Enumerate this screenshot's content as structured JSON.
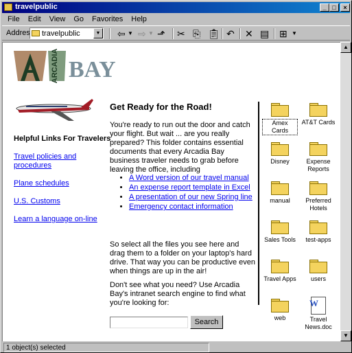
{
  "window": {
    "title": "travelpublic"
  },
  "menu": {
    "items": [
      "File",
      "Edit",
      "View",
      "Go",
      "Favorites",
      "Help"
    ]
  },
  "toolbar": {
    "address_label": "Address",
    "address_value": "travelpublic"
  },
  "logo": {
    "letter": "A",
    "word1": "ARCADIA",
    "word2": "BAY"
  },
  "sidebar": {
    "heading": "Helpful Links For Travelers",
    "links": [
      "Travel policies and procedures",
      "Plane schedules",
      "U.S. Customs",
      "Learn a language on-line"
    ]
  },
  "main": {
    "heading": "Get Ready for the Road!",
    "intro": "You're ready to run out the door and catch your flight. But wait ... are you really prepared? This folder contains essential documents that every Arcadia Bay business traveler needs to grab before leaving the office, including",
    "bullets": [
      "A Word version of our travel manual",
      "An expense report template in Excel",
      "A presentation of our new Spring line",
      "Emergency contact information"
    ],
    "para2": "So select all the files you see here and drag them to a folder on your laptop's hard drive. That way you can be productive even when things are up in the air!",
    "para3": "Don't see what you need? Use Arcadia Bay's intranet search engine to find what you're looking for:",
    "search_placeholder": "",
    "search_button": "Search"
  },
  "files": [
    "Amex Cards",
    "AT&T Cards",
    "Disney",
    "Expense Reports",
    "manual",
    "Preferred Hotels",
    "Sales Tools",
    "test-apps",
    "Travel Apps",
    "users",
    "web",
    "Travel News.doc"
  ],
  "status": {
    "text": "1 object(s) selected"
  },
  "colors": {
    "title_bar": "#000080",
    "link": "#0000ee",
    "folder": "#f4d35e"
  }
}
